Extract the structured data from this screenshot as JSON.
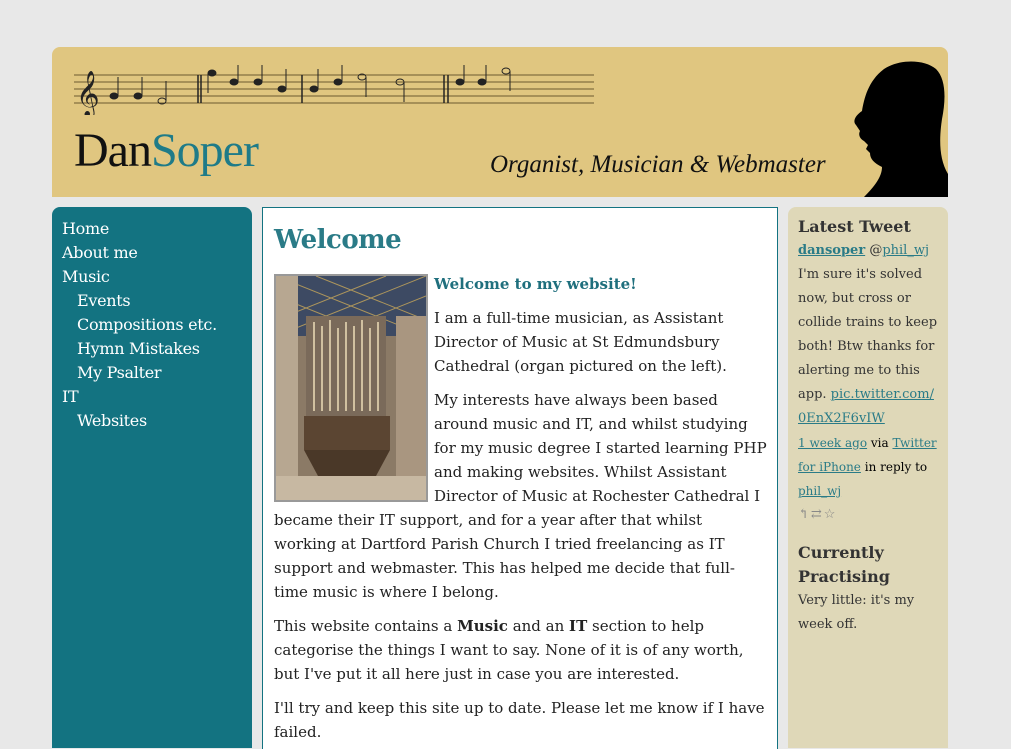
{
  "header": {
    "logo_first": "Dan",
    "logo_second": "Soper",
    "tagline": "Organist, Musician & Webmaster"
  },
  "nav": {
    "items": [
      {
        "label": "Home"
      },
      {
        "label": "About me"
      },
      {
        "label": "Music"
      },
      {
        "label": "Events"
      },
      {
        "label": "Compositions etc."
      },
      {
        "label": "Hymn Mistakes"
      },
      {
        "label": "My Psalter"
      },
      {
        "label": "IT"
      },
      {
        "label": "Websites"
      }
    ]
  },
  "main": {
    "title": "Welcome",
    "subtitle": "Welcome to my website!",
    "p1": "I am a full-time musician, as Assistant Director of Music at St Edmundsbury Cathedral (organ pictured on the left).",
    "p2": "My interests have always been based around music and IT, and whilst studying for my music degree I started learning PHP and making websites.  Whilst Assistant Director of Music at Rochester Cathedral I became their IT support, and for a year after that whilst working at Dartford Parish Church I tried freelancing as IT support and webmaster.  This has helped me decide that full-time music is where I belong.",
    "p3_a": "This website contains a ",
    "p3_music": "Music",
    "p3_b": " and an ",
    "p3_it": "IT",
    "p3_c": " section to help categorise the things I want to say.  None of it is of any worth, but I've put it all here just in case you are interested.",
    "p4": "I'll try and keep this site up to date.  Please let me know if I have failed."
  },
  "sidebar": {
    "tweet_heading": "Latest Tweet",
    "tweet_user": "dansoper",
    "tweet_at": "@",
    "tweet_mention": "phil_wj",
    "tweet_text": "I'm sure it's solved now, but cross or collide trains to keep both! Btw thanks for alerting me to this app.",
    "tweet_link": "pic.twitter.com/0EnX2F6vIW",
    "tweet_time": "1 week ago",
    "tweet_via": " via ",
    "tweet_client": "Twitter for iPhone",
    "tweet_reply_to": " in reply to ",
    "tweet_reply_user": "phil_wj",
    "tweet_actions": "↰⇄☆",
    "practising_heading": "Currently Practising",
    "practising_text": "Very little: it's my week off."
  }
}
